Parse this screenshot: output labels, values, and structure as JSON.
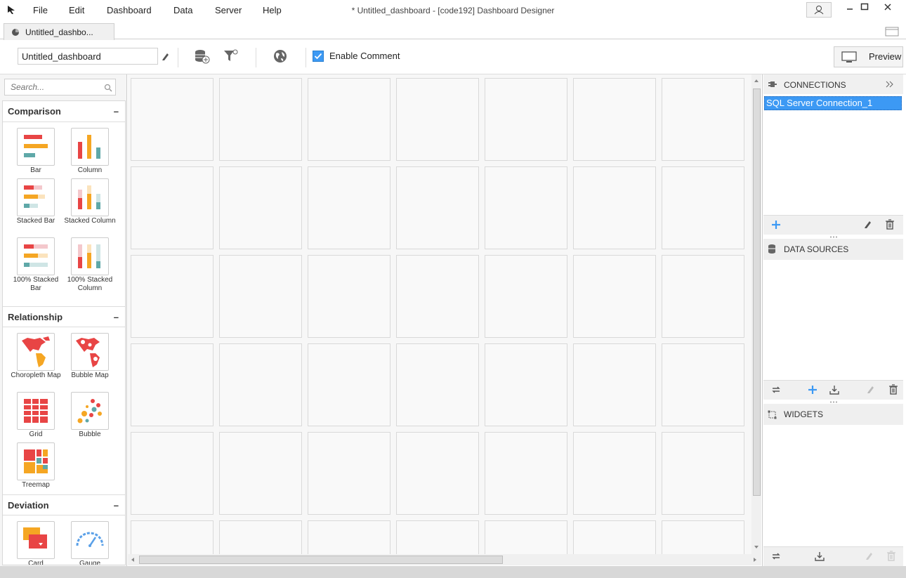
{
  "menu": [
    "File",
    "Edit",
    "Dashboard",
    "Data",
    "Server",
    "Help"
  ],
  "window_title": "* Untitled_dashboard - [code192] Dashboard Designer",
  "tab": {
    "label": "Untitled_dashbo..."
  },
  "toolbar": {
    "dashboard_name": "Untitled_dashboard",
    "enable_comment_label": "Enable Comment",
    "enable_comment_checked": true,
    "preview_label": "Preview"
  },
  "left_panel": {
    "search_placeholder": "Search...",
    "categories": [
      {
        "title": "Comparison",
        "items": [
          "Bar",
          "Column",
          "Stacked Bar",
          "Stacked Column",
          "100% Stacked Bar",
          "100% Stacked Column"
        ]
      },
      {
        "title": "Relationship",
        "items": [
          "Choropleth Map",
          "Bubble Map",
          "Grid",
          "Bubble",
          "Treemap"
        ]
      },
      {
        "title": "Deviation",
        "items": [
          "Card",
          "Gauge"
        ]
      }
    ],
    "collapse_symbol": "–"
  },
  "right_panel": {
    "connections_title": "CONNECTIONS",
    "connections": [
      "SQL Server Connection_1"
    ],
    "data_sources_title": "DATA SOURCES",
    "widgets_title": "WIDGETS"
  },
  "colors": {
    "accent": "#3c99f4",
    "red": "#e84545",
    "orange": "#f5a623",
    "teal": "#5fa8a8",
    "pink": "#f4c8cc"
  }
}
